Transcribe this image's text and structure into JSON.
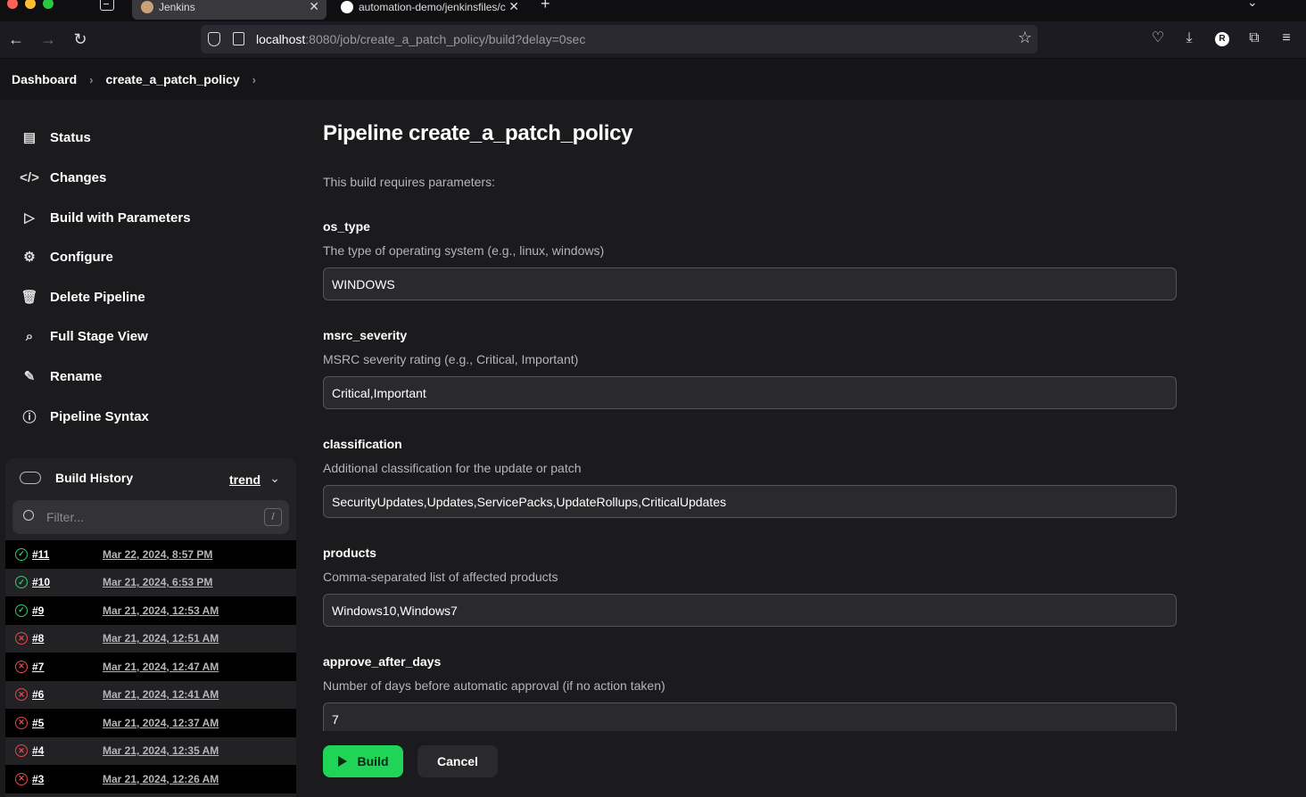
{
  "browser": {
    "tabs": [
      {
        "title": "Jenkins",
        "active": true
      },
      {
        "title": "automation-demo/jenkinsfiles/c",
        "active": false
      }
    ],
    "url_host": "localhost",
    "url_rest": ":8080/job/create_a_patch_policy/build?delay=0sec",
    "profile_initial": "R"
  },
  "breadcrumb": {
    "items": [
      "Dashboard",
      "create_a_patch_policy"
    ]
  },
  "sidebar": {
    "tasks": [
      {
        "label": "Status",
        "icon": "document-icon"
      },
      {
        "label": "Changes",
        "icon": "code-icon"
      },
      {
        "label": "Build with Parameters",
        "icon": "play-icon"
      },
      {
        "label": "Configure",
        "icon": "gear-icon"
      },
      {
        "label": "Delete Pipeline",
        "icon": "trash-icon"
      },
      {
        "label": "Full Stage View",
        "icon": "search-icon"
      },
      {
        "label": "Rename",
        "icon": "pencil-icon"
      },
      {
        "label": "Pipeline Syntax",
        "icon": "help-icon"
      }
    ]
  },
  "build_history": {
    "title": "Build History",
    "trend_label": "trend",
    "filter_placeholder": "Filter...",
    "filter_shortcut": "/",
    "builds": [
      {
        "number": "#11",
        "date": "Mar 22, 2024, 8:57 PM",
        "status": "success"
      },
      {
        "number": "#10",
        "date": "Mar 21, 2024, 6:53 PM",
        "status": "success"
      },
      {
        "number": "#9",
        "date": "Mar 21, 2024, 12:53 AM",
        "status": "success"
      },
      {
        "number": "#8",
        "date": "Mar 21, 2024, 12:51 AM",
        "status": "failed"
      },
      {
        "number": "#7",
        "date": "Mar 21, 2024, 12:47 AM",
        "status": "failed"
      },
      {
        "number": "#6",
        "date": "Mar 21, 2024, 12:41 AM",
        "status": "failed"
      },
      {
        "number": "#5",
        "date": "Mar 21, 2024, 12:37 AM",
        "status": "failed"
      },
      {
        "number": "#4",
        "date": "Mar 21, 2024, 12:35 AM",
        "status": "failed"
      },
      {
        "number": "#3",
        "date": "Mar 21, 2024, 12:26 AM",
        "status": "failed"
      }
    ]
  },
  "main": {
    "title": "Pipeline create_a_patch_policy",
    "intro": "This build requires parameters:",
    "parameters": [
      {
        "name": "os_type",
        "description": "The type of operating system (e.g., linux, windows)",
        "value": "WINDOWS"
      },
      {
        "name": "msrc_severity",
        "description": "MSRC severity rating (e.g., Critical, Important)",
        "value": "Critical,Important"
      },
      {
        "name": "classification",
        "description": "Additional classification for the update or patch",
        "value": "SecurityUpdates,Updates,ServicePacks,UpdateRollups,CriticalUpdates"
      },
      {
        "name": "products",
        "description": "Comma-separated list of affected products",
        "value": "Windows10,Windows7"
      },
      {
        "name": "approve_after_days",
        "description": "Number of days before automatic approval (if no action taken)",
        "value": "7"
      }
    ],
    "build_label": "Build",
    "cancel_label": "Cancel"
  },
  "colors": {
    "accent_green": "#1fd456",
    "success": "#2ecc71",
    "failure": "#e5484d",
    "background": "#1b1b1d"
  }
}
